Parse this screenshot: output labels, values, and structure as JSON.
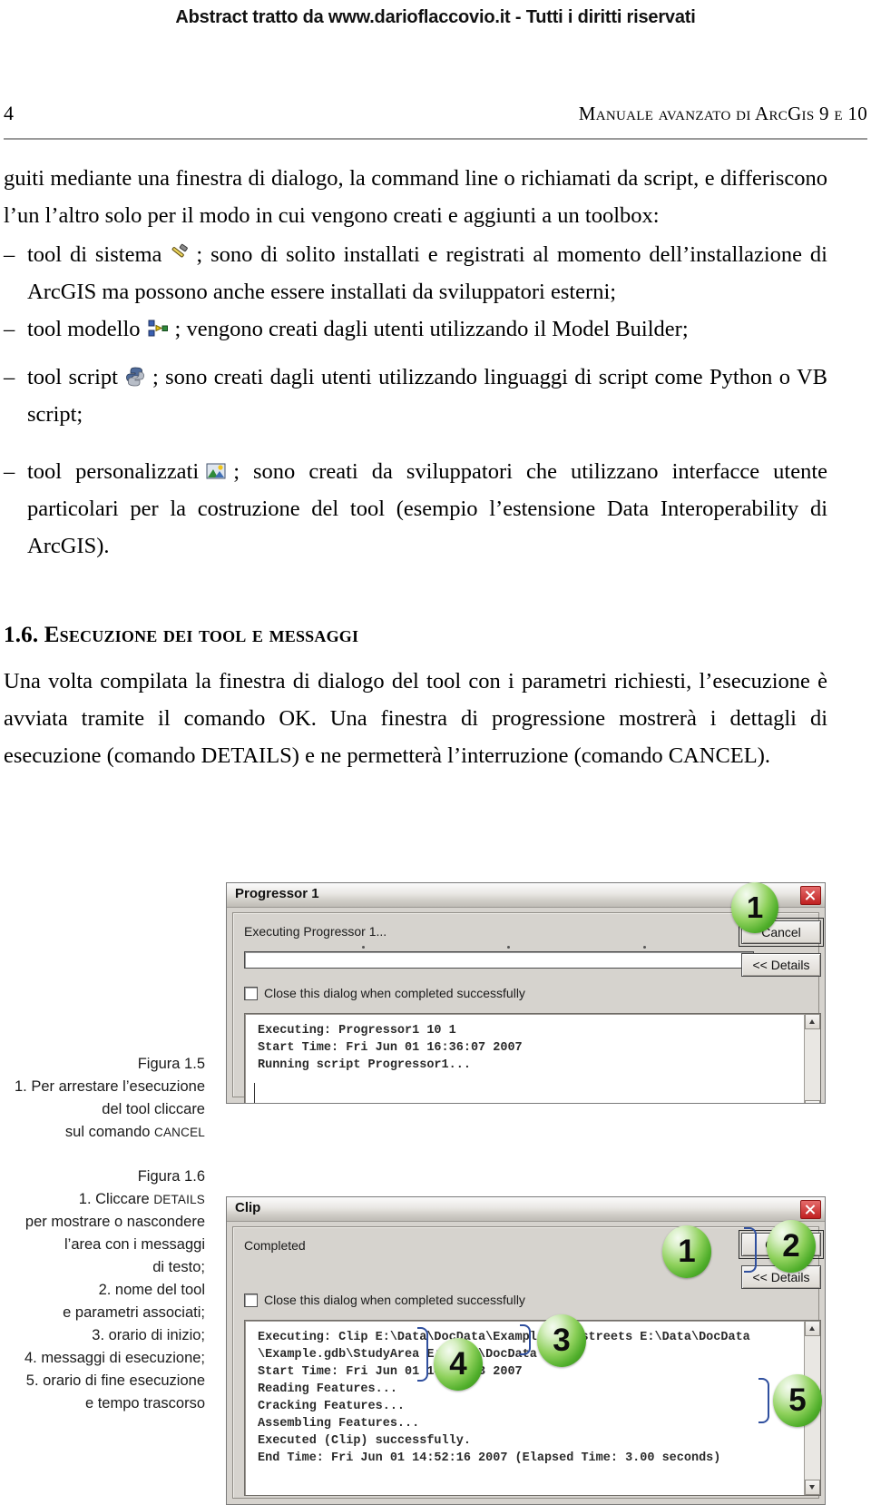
{
  "header": {
    "watermark": "Abstract tratto da www.darioflaccovio.it - Tutti i diritti riservati",
    "folio": "4",
    "running_title": "Manuale avanzato di ArcGis 9 e 10"
  },
  "body": {
    "para_intro": "guiti mediante una finestra di dialogo, la command line o richiamati da script, e differiscono l’un l’altro solo per il modo in cui vengono creati e aggiunti a un toolbox:",
    "bullets": [
      {
        "dash": "–",
        "pre": "tool di sistema",
        "icon": "hammer-icon",
        "post": "; sono di solito installati e registrati al momento dell’installazione di ArcGIS ma possono anche essere installati da sviluppatori esterni;"
      },
      {
        "dash": "–",
        "pre": "tool modello",
        "icon": "model-builder-icon",
        "post": "; vengono creati dagli utenti utilizzando il Model Builder;"
      },
      {
        "dash": "–",
        "pre": "tool script",
        "icon": "python-script-icon",
        "post": "; sono creati dagli utenti utilizzando linguaggi di script come Python o VB script;"
      },
      {
        "dash": "–",
        "pre": "tool personalizzati",
        "icon": "custom-tool-icon",
        "post": "; sono creati da sviluppatori che utilizzano interfacce utente particolari per la costruzione del tool (esempio l’estensione Data Interoperability di ArcGIS)."
      }
    ],
    "section_number": "1.6.",
    "section_title": "Esecuzione dei tool e messaggi",
    "para_section": "Una volta compilata la finestra di dialogo del tool con i parametri richiesti, l’esecuzione è avviata tramite il comando OK. Una finestra di progressione mostrerà i dettagli di esecuzione (comando DETAILS) e ne permetterà l’interruzione (comando CANCEL)."
  },
  "figure_1_5": {
    "caption_title": "Figura 1.5",
    "caption_lines": [
      "1. Per arrestare l’esecuzione",
      "del tool cliccare",
      "sul comando CANCEL"
    ],
    "caption_smallcaps_word": "CANCEL",
    "dialog": {
      "title": "Progressor 1",
      "status": "Executing Progressor 1...",
      "checkbox_label": "Close this dialog when completed successfully",
      "checkbox_checked": false,
      "progress_percent": 0,
      "buttons": [
        {
          "label": "Cancel",
          "name": "cancel-button",
          "default": true
        },
        {
          "label": "<< Details",
          "name": "details-button",
          "default": false
        }
      ],
      "log_lines": [
        "Executing: Progressor1 10 1",
        "Start Time: Fri Jun 01 16:36:07 2007",
        "Running script Progressor1..."
      ],
      "callouts": [
        {
          "number": "1"
        }
      ]
    }
  },
  "figure_1_6": {
    "caption_title": "Figura 1.6",
    "caption_lines": [
      "1. Cliccare DETAILS",
      "per mostrare o nascondere",
      "l’area con i messaggi",
      "di testo;",
      "2. nome del tool",
      "e parametri associati;",
      "3. orario di inizio;",
      "4. messaggi di esecuzione;",
      "5. orario di fine esecuzione",
      "e tempo trascorso"
    ],
    "dialog": {
      "title": "Clip",
      "status": "Completed",
      "checkbox_label": "Close this dialog when completed successfully",
      "checkbox_checked": false,
      "buttons": [
        {
          "label": "Close",
          "name": "close-button",
          "default": true
        },
        {
          "label": "<< Details",
          "name": "details-button",
          "default": false
        }
      ],
      "log_lines": [
        "Executing: Clip E:\\Data\\DocData\\Example.gdb\\streets E:\\Data\\DocData",
        "\\Example.gdb\\StudyArea E:\\Data\\DocData",
        "Start Time: Fri Jun 01 14:52:13 2007",
        "Reading Features...",
        "Cracking Features...",
        "Assembling Features...",
        "Executed (Clip) successfully.",
        "End Time: Fri Jun 01 14:52:16 2007 (Elapsed Time: 3.00 seconds)"
      ],
      "callouts": [
        {
          "number": "1"
        },
        {
          "number": "2"
        },
        {
          "number": "3"
        },
        {
          "number": "4"
        },
        {
          "number": "5"
        }
      ]
    }
  },
  "colors": {
    "callout_green": "#5cb02c",
    "brace_blue": "#2f4f9e",
    "dialog_face": "#d6d3ce",
    "close_red": "#c02020"
  }
}
